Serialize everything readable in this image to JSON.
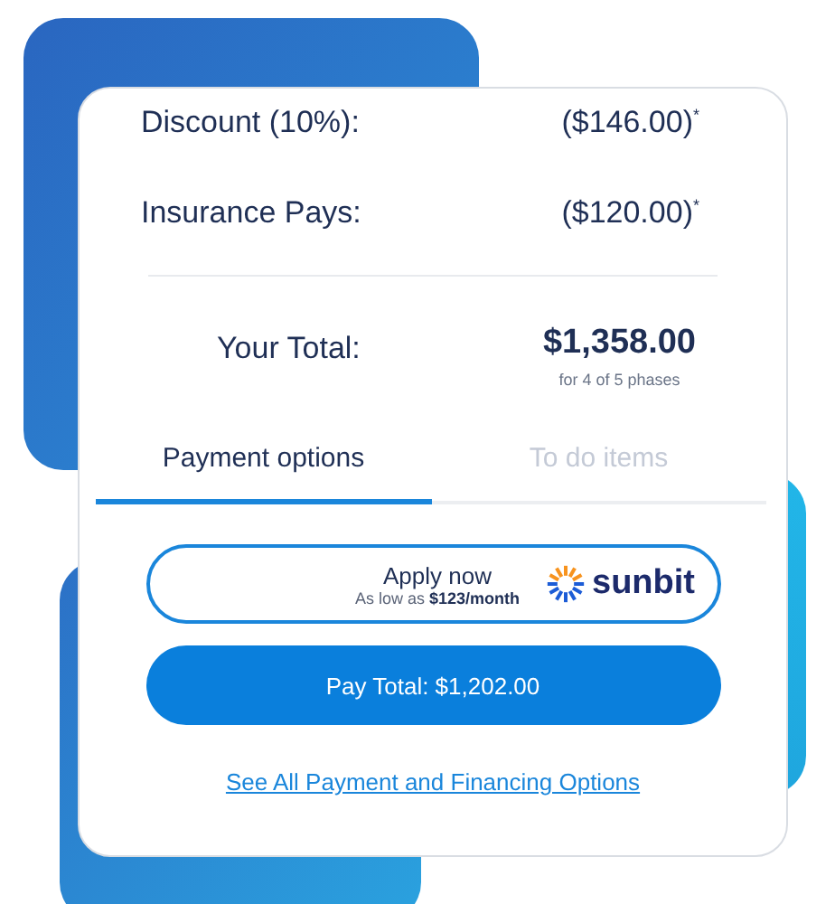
{
  "summary": [
    {
      "label": "Discount (10%):",
      "value": "($146.00)$^{*}$"
    },
    {
      "label": "Insurance Pays:",
      "value": "($120.00)$^{*}$"
    }
  ],
  "total": {
    "label": "Your Total:",
    "value": "$1,358.00",
    "note": "for 4 of 5 phases"
  },
  "tabs": [
    {
      "label": "Payment options",
      "selected": true
    },
    {
      "label": "To do items",
      "selected": false
    }
  ],
  "apply": {
    "title": "Apply now",
    "subtitle": "As low as **$123/month**",
    "brand": "sunbit"
  },
  "pay_button": "Pay Total: $1,202.00",
  "link": "See All Payment and Financing Options"
}
